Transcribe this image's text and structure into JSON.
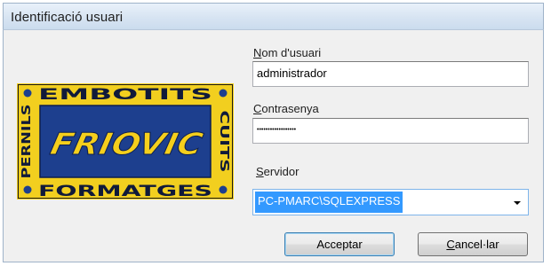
{
  "window": {
    "title": "Identificació usuari"
  },
  "logo": {
    "top_text": "EMBOTITS",
    "bottom_text": "FORMATGES",
    "left_text": "PERNILS",
    "right_text": "CUITS",
    "brand": "FRIOVIC",
    "colors": {
      "frame": "#f2cf1f",
      "center": "#1d3f8e",
      "brand_text": "#f5cf1c",
      "border_text": "#101a3a"
    }
  },
  "form": {
    "username": {
      "label_mnemonic": "N",
      "label_rest": "om d'usuari",
      "value": "administrador"
    },
    "password": {
      "label_mnemonic": "C",
      "label_rest": "ontrasenya",
      "value": "••••••••••••••••••"
    },
    "server": {
      "label_mnemonic": "S",
      "label_rest": "ervidor",
      "selected": "PC-PMARC\\SQLEXPRESS"
    }
  },
  "buttons": {
    "accept": "Acceptar",
    "cancel_mnemonic": "C",
    "cancel_rest": "ancel·lar"
  },
  "colors": {
    "selection": "#3399ff",
    "focus_border": "#7eb4ea"
  }
}
